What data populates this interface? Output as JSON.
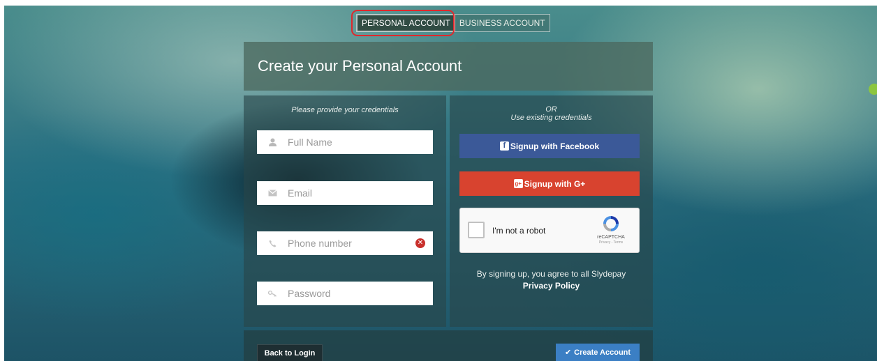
{
  "tabs": {
    "personal": "PERSONAL ACCOUNT",
    "business": "BUSINESS ACCOUNT"
  },
  "header": {
    "title": "Create your Personal Account"
  },
  "left_panel": {
    "note": "Please provide your credentials",
    "fields": {
      "full_name_placeholder": "Full Name",
      "email_placeholder": "Email",
      "phone_placeholder": "Phone number",
      "password_placeholder": "Password"
    }
  },
  "right_panel": {
    "or": "OR",
    "note": "Use existing credentials",
    "facebook_badge": "f",
    "facebook_label": "Signup with Facebook",
    "google_badge": "g+",
    "google_label": "Signup with G+",
    "recaptcha": {
      "label": "I'm not a robot",
      "brand": "reCAPTCHA",
      "terms": "Privacy - Terms"
    },
    "agree_text": "By signing up, you agree to all Slydepay",
    "privacy_link": "Privacy Policy"
  },
  "footer": {
    "back_label": "Back to Login",
    "create_label": "Create Account"
  },
  "colors": {
    "facebook": "#3b5998",
    "google": "#d8432f",
    "primary": "#3b7fc4",
    "highlight": "#e0282c"
  },
  "icons": {
    "full_name": "user-icon",
    "email": "envelope-icon",
    "phone": "phone-icon",
    "password": "key-icon",
    "clear": "clear-icon",
    "create": "check-icon"
  }
}
